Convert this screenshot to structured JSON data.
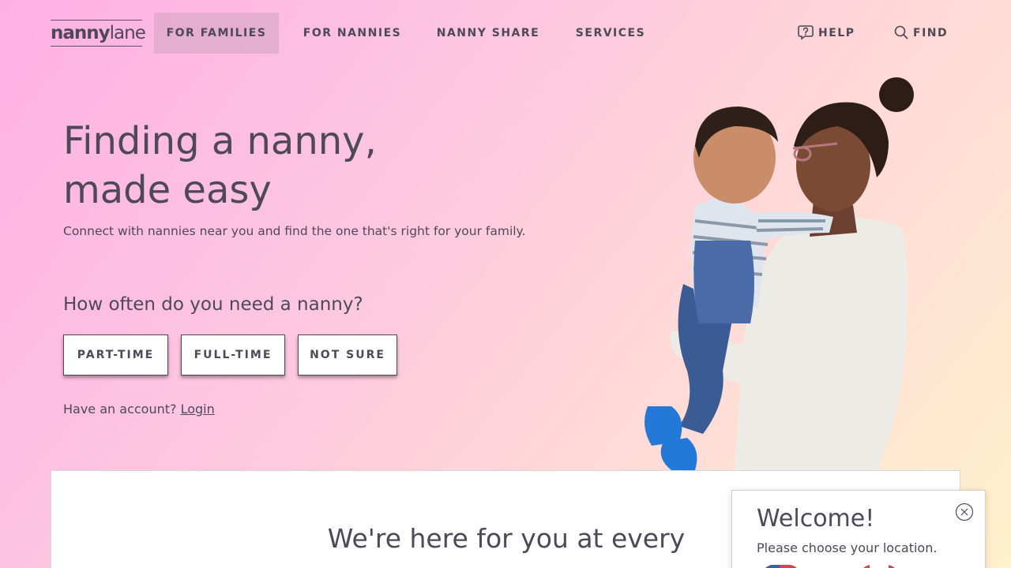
{
  "nav": {
    "logo_bold": "nanny",
    "logo_light": "lane",
    "items": [
      {
        "label": "FOR FAMILIES",
        "active": true
      },
      {
        "label": "FOR NANNIES",
        "active": false
      },
      {
        "label": "NANNY SHARE",
        "active": false
      },
      {
        "label": "SERVICES",
        "active": false
      }
    ],
    "help_label": "HELP",
    "find_label": "FIND"
  },
  "hero": {
    "title_line1": "Finding a nanny,",
    "title_line2": "made easy",
    "subtitle": "Connect with nannies near you and find the one that's right for your family.",
    "question": "How often do you need a nanny?",
    "options": [
      "PART-TIME",
      "FULL-TIME",
      "NOT SURE"
    ],
    "account_text": "Have an account?",
    "login_label": "Login"
  },
  "card": {
    "title": "We're here for you at every"
  },
  "popup": {
    "title": "Welcome!",
    "subtitle": "Please choose your location."
  },
  "colors": {
    "text": "#4d4956",
    "bg_start": "#fdb0e6",
    "bg_end": "#fff1cc"
  }
}
